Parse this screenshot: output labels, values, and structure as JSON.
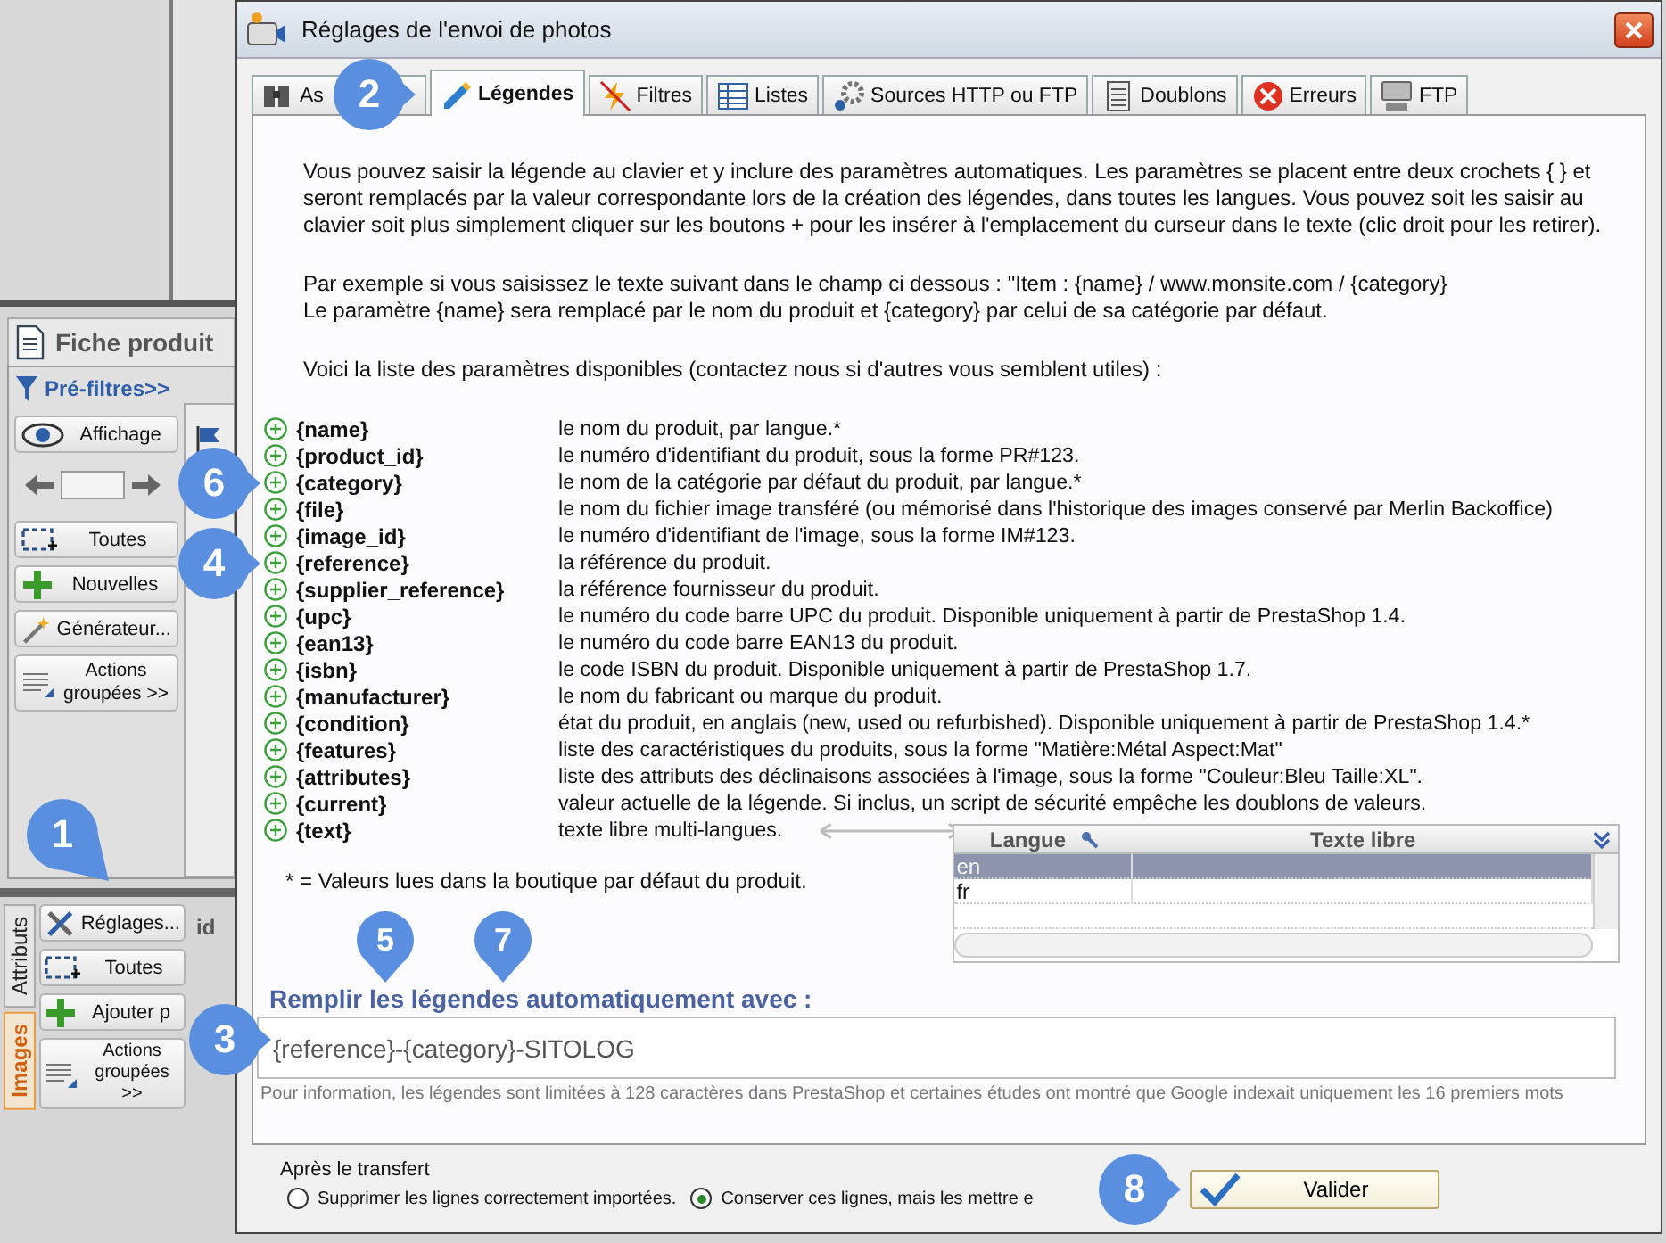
{
  "app": {
    "panel_tab": "Fiche produit",
    "prefilter": "Pré-filtres>>",
    "upper_buttons": [
      "Affichage",
      "Toutes",
      "Nouvelles",
      "Générateur...",
      "Actions groupées >>"
    ],
    "side_tabs": [
      {
        "label": "Attributs",
        "selected": false
      },
      {
        "label": "Images",
        "selected": true
      }
    ],
    "lower_buttons": [
      "Réglages...",
      "Toutes",
      "Ajouter p",
      "Actions groupées >>"
    ],
    "column_fragment": "id"
  },
  "window": {
    "title": "Réglages de l'envoi de photos"
  },
  "tabs": [
    {
      "label": "As",
      "selected": false
    },
    {
      "label": "Légendes",
      "selected": true
    },
    {
      "label": "Filtres",
      "selected": false
    },
    {
      "label": "Listes",
      "selected": false
    },
    {
      "label": "Sources HTTP ou FTP",
      "selected": false
    },
    {
      "label": "Doublons",
      "selected": false
    },
    {
      "label": "Erreurs",
      "selected": false
    },
    {
      "label": "FTP",
      "selected": false
    }
  ],
  "intro": [
    "Vous pouvez saisir la légende au clavier et y inclure des paramètres automatiques. Les paramètres se placent entre deux crochets { } et seront remplacés par la valeur correspondante lors de la création des légendes, dans toutes les langues. Vous pouvez soit les saisir au clavier soit plus simplement cliquer sur les boutons + pour les insérer à l'emplacement du curseur dans le texte (clic droit pour les retirer).",
    "Par exemple si vous saisissez le texte suivant dans le champ ci dessous : \"Item : {name} / www.monsite.com / {category}\nLe paramètre {name} sera remplacé par le nom du produit et {category} par celui de sa catégorie par défaut.",
    "Voici la liste des paramètres disponibles (contactez nous si d'autres vous semblent utiles) :"
  ],
  "parameters": [
    {
      "key": "{name}",
      "description": "le nom du produit, par langue.*"
    },
    {
      "key": "{product_id}",
      "description": "le numéro d'identifiant du produit, sous la forme PR#123."
    },
    {
      "key": "{category}",
      "description": "le nom de la catégorie par défaut du produit, par langue.*"
    },
    {
      "key": "{file}",
      "description": "le nom du fichier image transféré (ou mémorisé dans l'historique des images conservé par Merlin Backoffice)"
    },
    {
      "key": "{image_id}",
      "description": "le numéro d'identifiant de l'image, sous la forme IM#123."
    },
    {
      "key": "{reference}",
      "description": "la référence du produit."
    },
    {
      "key": "{supplier_reference}",
      "description": "la référence fournisseur du produit."
    },
    {
      "key": "{upc}",
      "description": "le numéro du code barre UPC du produit. Disponible uniquement à partir de PrestaShop 1.4."
    },
    {
      "key": "{ean13}",
      "description": "le numéro du code barre EAN13 du produit."
    },
    {
      "key": "{isbn}",
      "description": "le code ISBN du produit. Disponible uniquement à partir de PrestaShop 1.7."
    },
    {
      "key": "{manufacturer}",
      "description": "le nom du fabricant ou marque du produit."
    },
    {
      "key": "{condition}",
      "description": "état du produit, en anglais (new, used ou refurbished). Disponible uniquement à partir de PrestaShop 1.4.*"
    },
    {
      "key": "{features}",
      "description": "liste des caractéristiques du produits, sous la forme \"Matière:Métal Aspect:Mat\""
    },
    {
      "key": "{attributes}",
      "description": "liste des attributs des déclinaisons associées à l'image, sous la forme \"Couleur:Bleu Taille:XL\"."
    },
    {
      "key": "{current}",
      "description": "valeur actuelle de la légende. Si inclus, un script de sécurité empêche les doublons de valeurs."
    },
    {
      "key": "{text}",
      "description": "texte libre multi-langues."
    }
  ],
  "footnote": "* = Valeurs lues dans la boutique par défaut du produit.",
  "free_text_grid": {
    "columns": [
      "Langue",
      "Texte libre"
    ],
    "rows": [
      {
        "cells": [
          "en"
        ],
        "selected": true
      },
      {
        "cells": [
          "fr"
        ],
        "selected": false
      }
    ]
  },
  "caption_field": {
    "label": "Remplir les légendes automatiquement avec :",
    "value": "{reference}-{category}-SITOLOG"
  },
  "info": "Pour information, les légendes sont limitées à 128 caractères dans PrestaShop et certaines études ont montré que Google indexait uniquement les 16 premiers mots",
  "after_transfer": {
    "label": "Après le transfert",
    "options": [
      {
        "label": "Supprimer les lignes correctement importées.",
        "selected": false
      },
      {
        "label": "Conserver ces lignes, mais les mettre e",
        "selected": true
      }
    ]
  },
  "confirm_button": "Valider",
  "callouts": [
    {
      "number": "2"
    },
    {
      "number": "6"
    },
    {
      "number": "4"
    },
    {
      "number": "1"
    },
    {
      "number": "5"
    },
    {
      "number": "7"
    },
    {
      "number": "3"
    },
    {
      "number": "8"
    }
  ]
}
